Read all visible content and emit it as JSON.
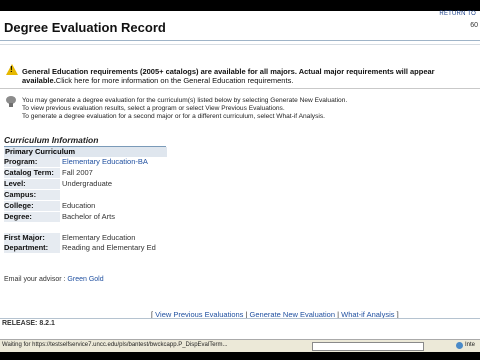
{
  "header": {
    "return_link": "RETURN TO",
    "title": "Degree Evaluation Record",
    "page_num": "60"
  },
  "warning": {
    "bold_text": "General Education requirements (2005+ catalogs) are available for all majors. Actual major requirements will appear",
    "bold_tail": "available.",
    "normal_tail": "Click here for more information on the General Education requirements."
  },
  "info": {
    "line1": "You may generate a degree evaluation for the curriculum(s) listed below by selecting Generate New Evaluation.",
    "line2": "To view previous evaluation results, select a program or select View Previous Evaluations.",
    "line3": "To generate a degree evaluation for a second major or for a different curriculum, select What-if Analysis."
  },
  "curriculum": {
    "section_title": "Curriculum Information",
    "primary_header": "Primary Curriculum",
    "program_label": "Program:",
    "program_value": "Elementary Education-BA",
    "catalog_label": "Catalog Term:",
    "catalog_value": "Fall 2007",
    "level_label": "Level:",
    "level_value": "Undergraduate",
    "campus_label": "Campus:",
    "campus_value": "",
    "college_label": "College:",
    "college_value": "Education",
    "degree_label": "Degree:",
    "degree_value": "Bachelor of Arts",
    "first_major_label": "First Major:",
    "first_major_value": "Elementary Education",
    "department_label": "Department:",
    "department_value": "Reading and Elementary Ed"
  },
  "advisor": {
    "label": "Email your advisor : ",
    "name": "Green Gold"
  },
  "links": {
    "open": "[ ",
    "view_previous": "View Previous Evaluations",
    "sep": " | ",
    "generate_new": "Generate New Evaluation",
    "what_if": "What-if Analysis",
    "close": " ]"
  },
  "footer": {
    "release": "RELEASE: 8.2.1"
  },
  "statusbar": {
    "text": "Waiting for https://testselfservice7.uncc.edu/pls/bantest/bwckcapp.P_DispEvalTerm...",
    "zone": "Inte"
  }
}
